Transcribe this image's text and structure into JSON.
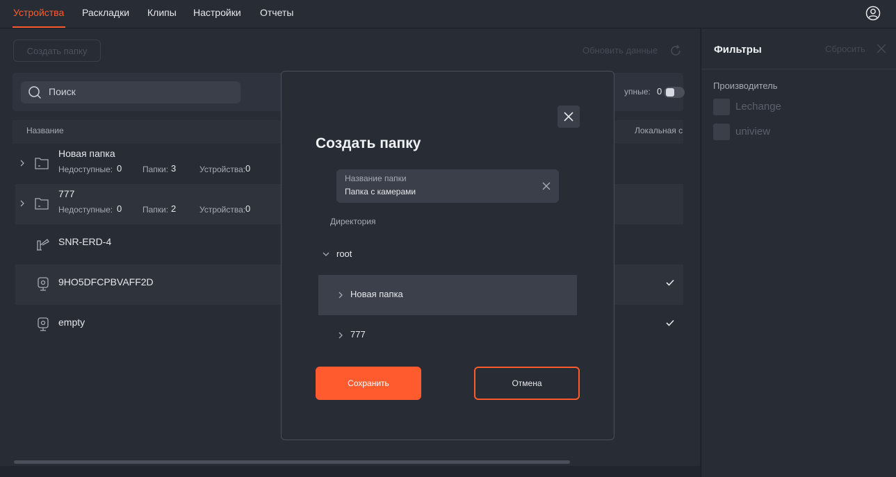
{
  "nav": {
    "tabs": [
      {
        "label": "Устройства",
        "active": true
      },
      {
        "label": "Раскладки"
      },
      {
        "label": "Клипы"
      },
      {
        "label": "Настройки"
      },
      {
        "label": "Отчеты"
      }
    ],
    "user_icon": "user-circle-icon"
  },
  "toolbar": {
    "create_folder_label": "Создать папку",
    "refresh_label": "Обновить данные"
  },
  "search": {
    "placeholder": "Поиск"
  },
  "unavailable_filter": {
    "label": "упные:",
    "count": "0"
  },
  "table": {
    "headers": {
      "name": "Название",
      "local": "Локальная с"
    },
    "rows": [
      {
        "type": "folder",
        "title": "Новая папка",
        "stats": {
          "unavailable_label": "Недоступные:",
          "unavailable": "0",
          "folders_label": "Папки:",
          "folders": "3",
          "devices_label": "Устройства:",
          "devices": "0"
        }
      },
      {
        "type": "folder",
        "title": "777",
        "stats": {
          "unavailable_label": "Недоступные:",
          "unavailable": "0",
          "folders_label": "Папки:",
          "folders": "2",
          "devices_label": "Устройства:",
          "devices": "0"
        }
      },
      {
        "type": "device-nvr",
        "title": "SNR-ERD-4"
      },
      {
        "type": "camera",
        "title": "9HO5DFCPBVAFF2D",
        "local": true
      },
      {
        "type": "camera",
        "title": "empty",
        "local": true
      }
    ]
  },
  "filters": {
    "title": "Фильтры",
    "reset_label": "Сбросить",
    "section_title": "Производитель",
    "vendors": [
      "Lechange",
      "uniview"
    ]
  },
  "modal": {
    "title": "Создать папку",
    "name_field_label": "Название папки",
    "name_field_value": "Папка с камерами",
    "directory_label": "Директория",
    "tree": {
      "root_label": "root",
      "children": [
        {
          "label": "Новая папка",
          "selected": true
        },
        {
          "label": "777",
          "selected": false
        }
      ]
    },
    "save_label": "Сохранить",
    "cancel_label": "Отмена"
  },
  "colors": {
    "accent": "#ff5b2e",
    "background": "#272c35",
    "panel": "#2e333d",
    "input": "#3a3f49"
  }
}
